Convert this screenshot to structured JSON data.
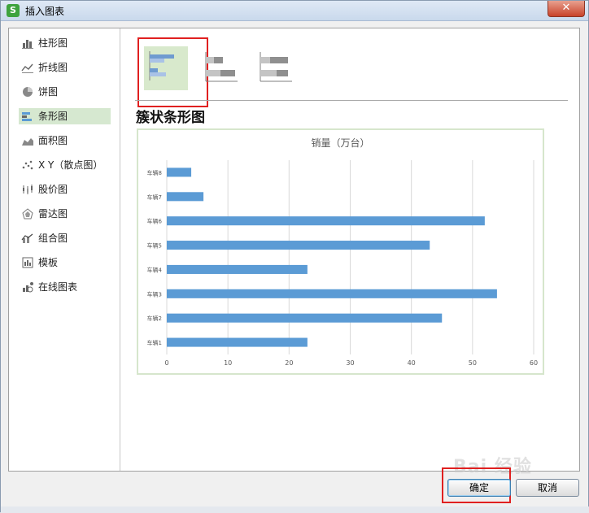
{
  "window": {
    "title": "插入图表",
    "app_icon_letter": "S",
    "close_symbol": "✕"
  },
  "sidebar": {
    "items": [
      {
        "label": "柱形图",
        "icon": "column-chart-icon"
      },
      {
        "label": "折线图",
        "icon": "line-chart-icon"
      },
      {
        "label": "饼图",
        "icon": "pie-chart-icon"
      },
      {
        "label": "条形图",
        "icon": "bar-chart-icon",
        "selected": true
      },
      {
        "label": "面积图",
        "icon": "area-chart-icon"
      },
      {
        "label": "X Y（散点图）",
        "icon": "scatter-chart-icon"
      },
      {
        "label": "股价图",
        "icon": "stock-chart-icon"
      },
      {
        "label": "雷达图",
        "icon": "radar-chart-icon"
      },
      {
        "label": "组合图",
        "icon": "combo-chart-icon"
      },
      {
        "label": "模板",
        "icon": "template-icon"
      },
      {
        "label": "在线图表",
        "icon": "online-chart-icon"
      }
    ]
  },
  "subtypes": {
    "selected_title": "簇状条形图",
    "items": [
      "clustered-bar",
      "stacked-bar",
      "percent-stacked-bar"
    ]
  },
  "chart_data": {
    "type": "bar",
    "orientation": "horizontal",
    "title": "销量（万台）",
    "categories": [
      "车辆1",
      "车辆2",
      "车辆3",
      "车辆4",
      "车辆5",
      "车辆6",
      "车辆7",
      "车辆8"
    ],
    "values": [
      23,
      45,
      54,
      23,
      43,
      52,
      6,
      4
    ],
    "xlim": [
      0,
      60
    ],
    "xticks": [
      0,
      10,
      20,
      30,
      40,
      50,
      60
    ],
    "grid": true,
    "bar_color": "#5b9bd5"
  },
  "buttons": {
    "ok_label": "确定",
    "cancel_label": "取消"
  },
  "watermark": "Bai 经验",
  "colors": {
    "accent_green": "#3ea33e",
    "selection_red": "#e02020",
    "selected_item_bg": "#d6e8d0"
  }
}
